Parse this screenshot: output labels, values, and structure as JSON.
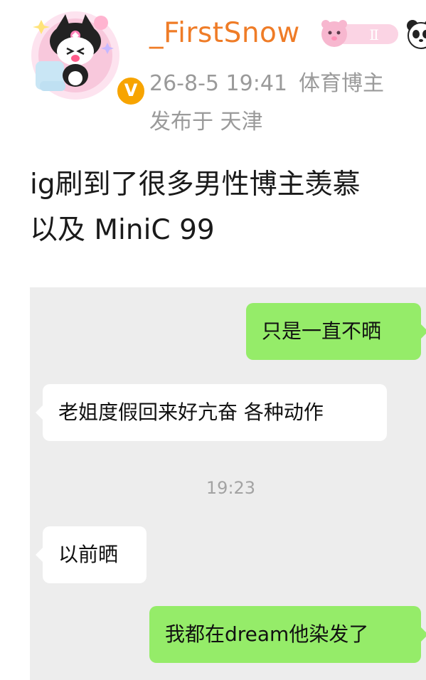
{
  "author": {
    "username": "_FirstSnow",
    "verified_badge": "V",
    "rank_badge": "Ⅱ",
    "timestamp": "26-8-5 19:41",
    "role": "体育博主",
    "location": "发布于 天津"
  },
  "post": {
    "text_line1": "ig刷到了很多男性博主羡慕",
    "text_line2": "以及 MiniC 99"
  },
  "chat": {
    "messages": [
      {
        "sender": "me",
        "text": "只是一直不晒"
      },
      {
        "sender": "them",
        "text": "老姐度假回来好亢奋 各种动作"
      },
      {
        "sender": "them",
        "text": "以前晒"
      },
      {
        "sender": "me",
        "text": "我都在dream他染发了"
      }
    ],
    "time": "19:23"
  },
  "colors": {
    "username": "#ef7c27",
    "meta_gray": "#9a9a9a",
    "chat_background": "#ededed",
    "my_bubble": "#95ec69",
    "their_bubble": "#ffffff",
    "verified_badge": "#f7a400"
  },
  "icons": {
    "avatar": "kuromi-avatar-icon",
    "rank_badge": "pink-bear-rank-icon",
    "panda_badge": "panda-icon"
  }
}
